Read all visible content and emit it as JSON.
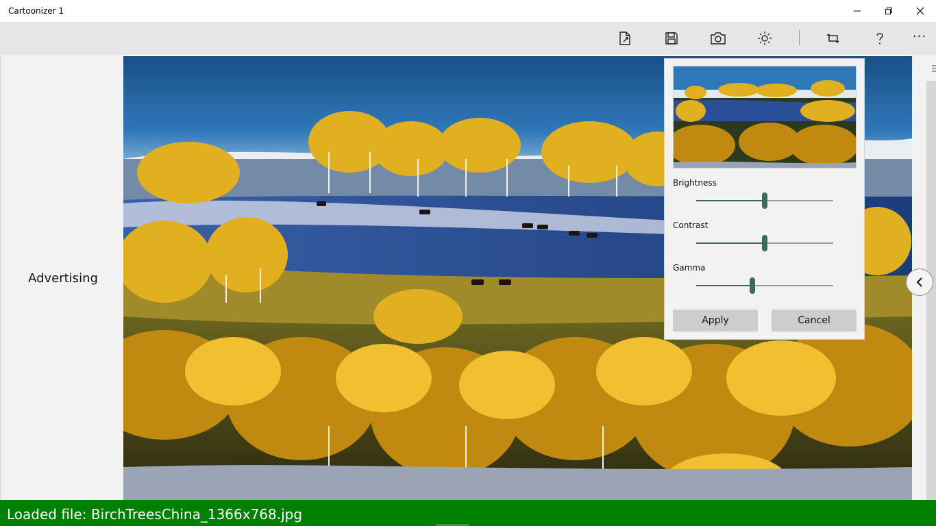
{
  "window": {
    "title": "Cartoonizer 1",
    "controls": [
      "minimize-icon",
      "restore-icon",
      "close-icon"
    ]
  },
  "toolbar": {
    "buttons": [
      "open-file-icon",
      "save-icon",
      "camera-icon",
      "brightness-icon",
      "crop-rotate-icon",
      "help-icon",
      "more-icon"
    ],
    "more_label": "···"
  },
  "ad_pane": {
    "label": "Advertising"
  },
  "adjust_panel": {
    "sliders": [
      {
        "label": "Brightness",
        "value": 0.5
      },
      {
        "label": "Contrast",
        "value": 0.5
      },
      {
        "label": "Gamma",
        "value": 0.41
      }
    ],
    "apply_label": "Apply",
    "cancel_label": "Cancel",
    "accent_color": "#3e6b59"
  },
  "status_bar": {
    "text": "Loaded file: BirchTreesChina_1366x768.jpg",
    "color": "#008000"
  }
}
